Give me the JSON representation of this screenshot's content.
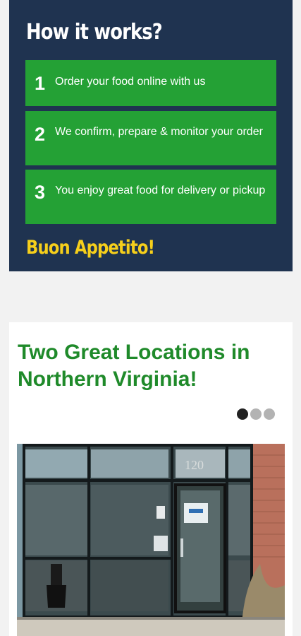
{
  "how_it_works": {
    "title": "How it works?",
    "steps": [
      {
        "number": "1",
        "text": "Order your food online with us"
      },
      {
        "number": "2",
        "text": "We confirm, prepare & monitor your order"
      },
      {
        "number": "3",
        "text": "You enjoy great food for delivery or pickup"
      }
    ],
    "closing": "Buon Appetito!"
  },
  "locations": {
    "title": "Two Great Locations in Northern Virginia!",
    "carousel": {
      "slide_count": 3,
      "active_index": 0,
      "storefront_unit_number": "120"
    }
  },
  "colors": {
    "panel_background": "#1f3350",
    "step_green": "#24a135",
    "accent_yellow": "#f6cf1b",
    "heading_green": "#1f8a2a"
  }
}
